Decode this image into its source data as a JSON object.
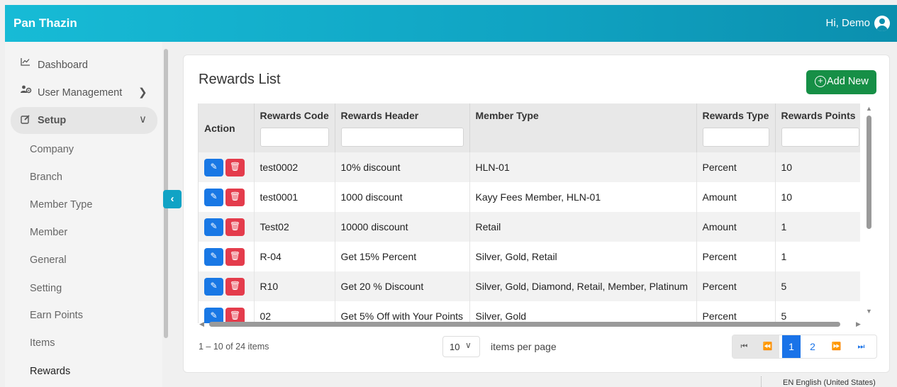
{
  "header": {
    "brand": "Pan Thazin",
    "greeting": "Hi, Demo",
    "user_icon": "user-circle-icon"
  },
  "sidebar": {
    "dashboard": "Dashboard",
    "user_management": "User Management",
    "setup": "Setup",
    "setup_items": [
      "Company",
      "Branch",
      "Member Type",
      "Member",
      "General",
      "Setting",
      "Earn Points",
      "Items",
      "Rewards"
    ]
  },
  "page": {
    "title": "Rewards List",
    "add_label": "Add New"
  },
  "table": {
    "columns": [
      "Action",
      "Rewards Code",
      "Rewards Header",
      "Member Type",
      "Rewards Type",
      "Rewards Points"
    ],
    "rows": [
      [
        "test0002",
        "10% discount",
        "HLN-01",
        "Percent",
        "10"
      ],
      [
        "test0001",
        "1000 discount",
        "Kayy Fees Member, HLN-01",
        "Amount",
        "10"
      ],
      [
        "Test02",
        "10000 discount",
        "Retail",
        "Amount",
        "1"
      ],
      [
        "R-04",
        "Get 15% Percent",
        "Silver, Gold, Retail",
        "Percent",
        "1"
      ],
      [
        "R10",
        "Get 20 % Discount",
        "Silver, Gold, Diamond, Retail, Member, Platinum",
        "Percent",
        "5"
      ],
      [
        "02",
        "Get 5% Off with Your Points",
        "Silver, Gold",
        "Percent",
        "5"
      ]
    ]
  },
  "pagination": {
    "info": "1 – 10 of 24 items",
    "page_size": "10",
    "items_per_page": "items per page",
    "pages": [
      "1",
      "2"
    ],
    "current": "1"
  },
  "status": {
    "lang": "EN English (United States)"
  },
  "colors": {
    "header": "#10a3c2",
    "primary": "#1a73e8",
    "add": "#168f46",
    "delete": "#e43c4c"
  }
}
